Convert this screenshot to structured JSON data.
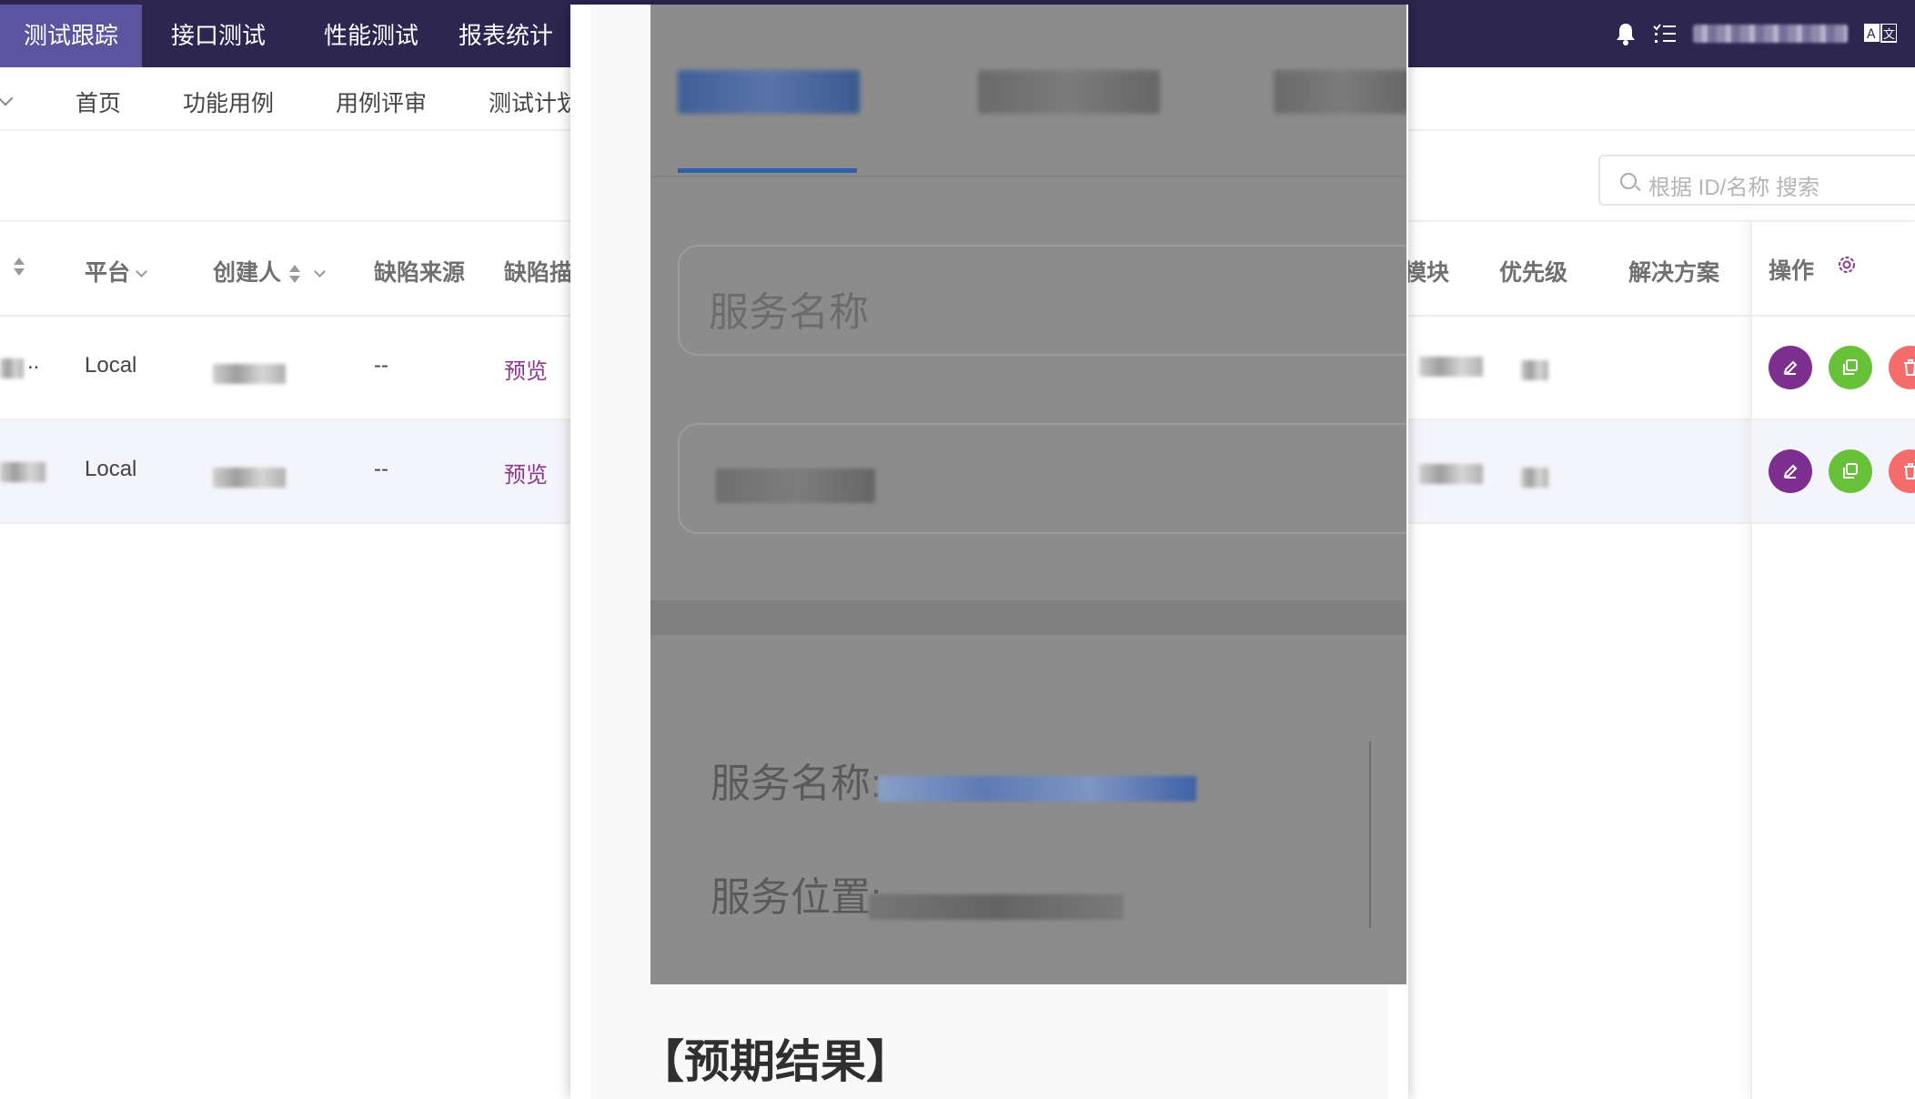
{
  "topnav": {
    "tabs": [
      "测试跟踪",
      "接口测试",
      "性能测试",
      "报表统计"
    ],
    "active_index": 0
  },
  "subnav": {
    "items": [
      "首页",
      "功能用例",
      "用例评审",
      "测试计划"
    ]
  },
  "search": {
    "placeholder": "根据 ID/名称 搜索"
  },
  "table": {
    "headers_left": [
      "平台",
      "创建人",
      "缺陷来源",
      "缺陷描"
    ],
    "headers_right": [
      "模块",
      "优先级",
      "解决方案",
      "操作"
    ],
    "rows": [
      {
        "tail": "..",
        "platform": "Local",
        "source": "--",
        "preview": "预览"
      },
      {
        "tail": "",
        "platform": "Local",
        "source": "--",
        "preview": "预览"
      }
    ]
  },
  "preview": {
    "field_label": "服务名称",
    "kv": [
      {
        "label": "服务名称:"
      },
      {
        "label": "服务位置:"
      }
    ],
    "expected_title": "【预期结果】"
  },
  "colors": {
    "topbar": "#2c2650",
    "active_tab": "#5b55a0",
    "edit": "#7c2f8e",
    "copy": "#67c23a",
    "delete": "#f56c6c",
    "link": "#8a3a8a"
  }
}
